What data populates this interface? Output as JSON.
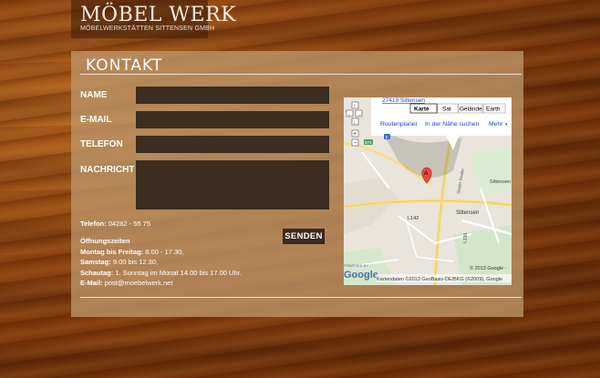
{
  "logo": {
    "brand": "MÖBEL WERK",
    "tagline": "MÖBELWERKSTÄTTEN SITTENSEN GMBH"
  },
  "contact": {
    "heading": "KONTAKT",
    "form": {
      "name_label": "NAME",
      "email_label": "E-MAIL",
      "phone_label": "TELEFON",
      "message_label": "NACHRICHT",
      "submit_label": "SENDEN"
    },
    "info": {
      "phone_label": "Telefon:",
      "phone_value": "04282 - 55 75",
      "hours_heading": "Öffnungszeiten",
      "weekdays_label": "Montag bis Freitag:",
      "weekdays_value": "8.00 - 17.30,",
      "saturday_label": "Samstag:",
      "saturday_value": "9.00 bis 12.30,",
      "sunday_label": "Schautag:",
      "sunday_value": "1. Sonntag im Monat 14.00 bis 17.00 Uhr.",
      "email_label": "E-Mail:",
      "email_value": "post@moebelwerk.net"
    }
  },
  "map": {
    "address_link": "27419 Sittensen",
    "map_types": [
      "Karte",
      "Sat",
      "Gelände",
      "Earth"
    ],
    "actions": [
      "Routenplaner",
      "In der Nähe suchen",
      "Mehr"
    ],
    "marker_label": "A",
    "place_labels": [
      "Sittensen",
      "Sittensen",
      "L142",
      "L130",
      "Stader Straße"
    ],
    "road_shields": [
      "B71",
      "E"
    ],
    "powered_by": "POWERED BY",
    "logo": "Google",
    "copyright": "© 2013 Google -",
    "attribution": "Kartendaten ©2013 GeoBasis-DE/BKG (©2009), Google"
  }
}
